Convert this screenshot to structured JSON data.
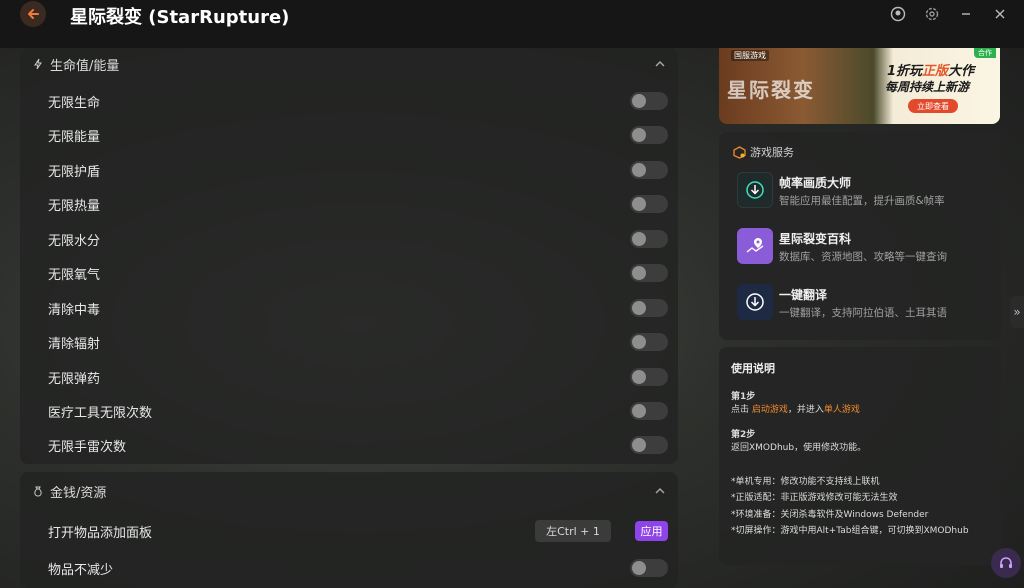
{
  "titlebar": {
    "title": "星际裂变 (StarRupture)"
  },
  "sections": [
    {
      "title": "生命值/能量",
      "icon": "lightning-icon",
      "rows": [
        {
          "label": "无限生命",
          "type": "toggle",
          "on": false
        },
        {
          "label": "无限能量",
          "type": "toggle",
          "on": false
        },
        {
          "label": "无限护盾",
          "type": "toggle",
          "on": false
        },
        {
          "label": "无限热量",
          "type": "toggle",
          "on": false
        },
        {
          "label": "无限水分",
          "type": "toggle",
          "on": false
        },
        {
          "label": "无限氧气",
          "type": "toggle",
          "on": false
        },
        {
          "label": "清除中毒",
          "type": "toggle",
          "on": false
        },
        {
          "label": "清除辐射",
          "type": "toggle",
          "on": false
        },
        {
          "label": "无限弹药",
          "type": "toggle",
          "on": false
        },
        {
          "label": "医疗工具无限次数",
          "type": "toggle",
          "on": false
        },
        {
          "label": "无限手雷次数",
          "type": "toggle",
          "on": false
        }
      ]
    },
    {
      "title": "金钱/资源",
      "icon": "money-bag-icon",
      "rows": [
        {
          "label": "打开物品添加面板",
          "type": "hotkey",
          "hotkey": "左Ctrl + 1",
          "button": "应用"
        },
        {
          "label": "物品不减少",
          "type": "toggle",
          "on": false
        }
      ]
    }
  ],
  "banner": {
    "tag_left": "国服游戏",
    "tag_right": "合作",
    "art_title": "星际裂变",
    "promo_line1_a": "1折玩",
    "promo_line1_b": "正版",
    "promo_line1_c": "大作",
    "promo_line2": "每周持续上新游",
    "cta": "立即查看"
  },
  "services": {
    "title": "游戏服务",
    "items": [
      {
        "name": "帧率画质大师",
        "desc": "智能应用最佳配置，提升画质&帧率",
        "icon": "download-icon"
      },
      {
        "name": "星际裂变百科",
        "desc": "数据库、资源地图、攻略等一键查询",
        "icon": "map-pin-icon"
      },
      {
        "name": "一键翻译",
        "desc": "一键翻译，支持阿拉伯语、土耳其语",
        "icon": "download-icon"
      }
    ]
  },
  "instructions": {
    "title": "使用说明",
    "step1_title": "第1步",
    "step1_a": "点击 ",
    "step1_link1": "启动游戏",
    "step1_b": "，并进入",
    "step1_link2": "单人游戏",
    "step2_title": "第2步",
    "step2_text": "返回XMODhub，使用修改功能。",
    "notes": [
      "*单机专用：修改功能不支持线上联机",
      "*正版适配：非正版游戏修改可能无法生效",
      "*环境准备：关闭杀毒软件及Windows Defender",
      "*切屏操作：游戏中用Alt+Tab组合键，可切换到XMODhub"
    ]
  },
  "colors": {
    "accent_purple": "#8e44e8",
    "accent_orange": "#f08a2f"
  }
}
